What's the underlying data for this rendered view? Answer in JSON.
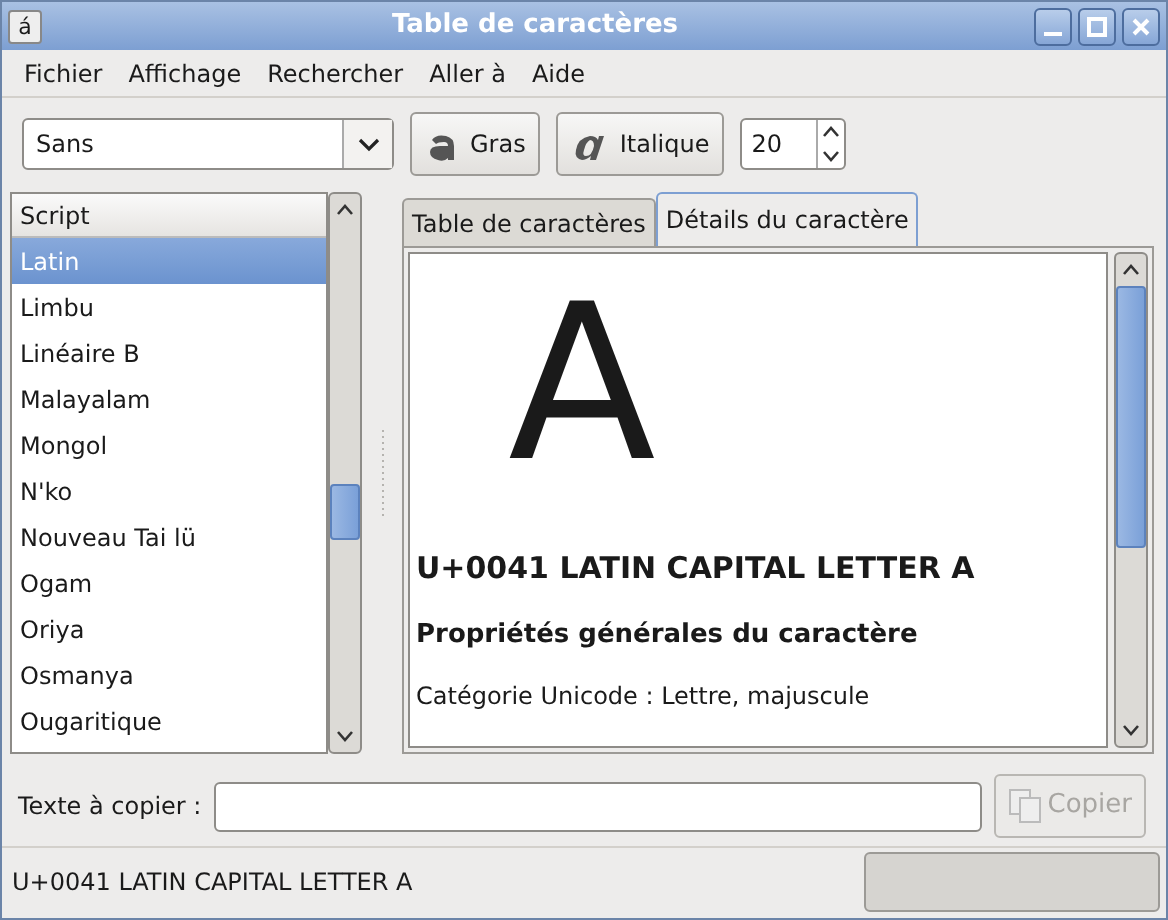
{
  "window": {
    "title": "Table de caractères",
    "app_icon": "á"
  },
  "menu": [
    "Fichier",
    "Affichage",
    "Rechercher",
    "Aller à",
    "Aide"
  ],
  "toolbar": {
    "font": "Sans",
    "bold_button": "Gras",
    "italic_button": "Italique",
    "size": "20"
  },
  "script_list": {
    "header": "Script",
    "items": [
      {
        "label": "Latin",
        "selected": true
      },
      {
        "label": "Limbu",
        "selected": false
      },
      {
        "label": "Linéaire B",
        "selected": false
      },
      {
        "label": "Malayalam",
        "selected": false
      },
      {
        "label": "Mongol",
        "selected": false
      },
      {
        "label": "N'ko",
        "selected": false
      },
      {
        "label": "Nouveau Tai lü",
        "selected": false
      },
      {
        "label": "Ogam",
        "selected": false
      },
      {
        "label": "Oriya",
        "selected": false
      },
      {
        "label": "Osmanya",
        "selected": false
      },
      {
        "label": "Ougaritique",
        "selected": false
      }
    ]
  },
  "tabs": [
    {
      "label": "Table de caractères",
      "selected": false
    },
    {
      "label": "Détails du caractère",
      "selected": true
    }
  ],
  "details": {
    "glyph": "A",
    "name": "U+0041 LATIN CAPITAL LETTER A",
    "section": "Propriétés générales du caractère",
    "line": "Catégorie Unicode : Lettre, majuscule"
  },
  "copy": {
    "label": "Texte à copier :",
    "button": "Copier",
    "disabled": true
  },
  "status_bar": {
    "text": "U+0041 LATIN CAPITAL LETTER A"
  }
}
